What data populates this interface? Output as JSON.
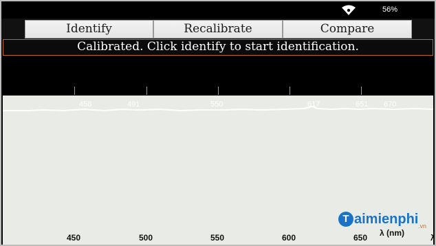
{
  "status_bar": {
    "wifi_icon": "wifi-icon",
    "battery_level": "56%"
  },
  "toolbar": {
    "identify_label": "Identify",
    "recalibrate_label": "Recalibrate",
    "compare_label": "Compare"
  },
  "message": "Calibrated. Click identify to start identification.",
  "spectrum": {
    "peak_labels": [
      "458",
      "491",
      "550",
      "617",
      "651",
      "670"
    ],
    "axis_labels": [
      "450",
      "500",
      "550",
      "600",
      "650"
    ],
    "axis_unit": "λ (nm)",
    "axis_edge_symbol": "λ"
  },
  "watermark": {
    "logo_letter": "T",
    "name": "aimienphi",
    "suffix": ".vn"
  },
  "colors": {
    "background": "#000000",
    "button_face": "#eeeeee",
    "message_border": "#c06a1a",
    "spectrum_bg": "#e9ebe6",
    "watermark_blue": "#1b73c5",
    "watermark_orange": "#e56c1a"
  }
}
